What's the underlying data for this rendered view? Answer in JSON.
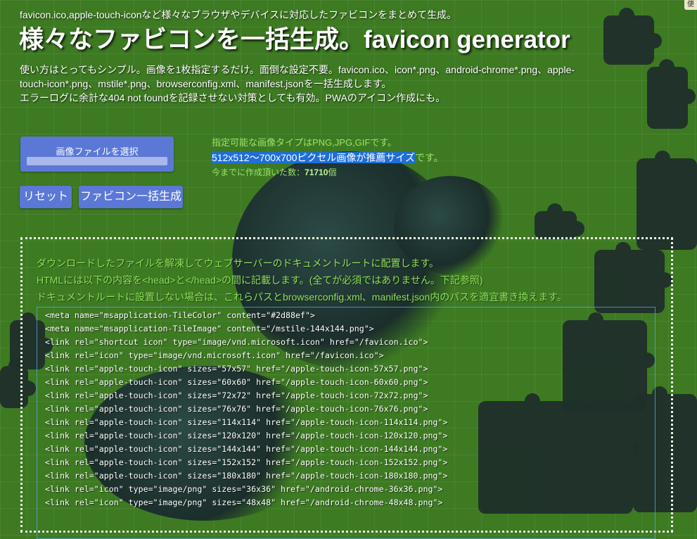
{
  "header": {
    "tagline": "favicon.ico,apple-touch-iconなど様々なブラウザやデバイスに対応したファビコンをまとめて生成。",
    "title": "様々なファビコンを一括生成。favicon generator"
  },
  "intro": {
    "lines": [
      "使い方はとってもシンプル。画像を1枚指定するだけ。面倒な設定不要。favicon.ico、icon*.png、android-chrome*.png、apple-",
      "touch-icon*.png、mstile*.png、browserconfig.xml、manifest.jsonを一括生成します。",
      "エラーログに余計な404 not foundを記録させない対策としても有効。PWAのアイコン作成にも。"
    ]
  },
  "upload": {
    "file_button_label": "画像ファイルを選択"
  },
  "info": {
    "types": "指定可能な画像タイプはPNG,JPG,GIFです。",
    "size_selected": "512x512～700x700ピクセル画像が推薦サイズ",
    "size_suffix": "です。",
    "count_label": "今までに作成頂いた数：",
    "count_value": "71710",
    "count_unit": "個"
  },
  "actions": {
    "reset_label": "リセット",
    "generate_label": "ファビコン一括生成"
  },
  "panel": {
    "lines": [
      "ダウンロードしたファイルを解凍してウェブサーバーのドキュメントルートに配置します。",
      "HTMLには以下の内容を<head>と</head>の間に記載します。(全てが必須ではありません。下記参照)",
      "ドキュメントルートに設置しない場合は、これらパスとbrowserconfig.xml、manifest.json内のパスを適宜書き換えます。"
    ],
    "code": [
      "<meta name=\"msapplication-TileColor\" content=\"#2d88ef\">",
      "<meta name=\"msapplication-TileImage\" content=\"/mstile-144x144.png\">",
      "<link rel=\"shortcut icon\" type=\"image/vnd.microsoft.icon\" href=\"/favicon.ico\">",
      "<link rel=\"icon\" type=\"image/vnd.microsoft.icon\" href=\"/favicon.ico\">",
      "<link rel=\"apple-touch-icon\" sizes=\"57x57\" href=\"/apple-touch-icon-57x57.png\">",
      "<link rel=\"apple-touch-icon\" sizes=\"60x60\" href=\"/apple-touch-icon-60x60.png\">",
      "<link rel=\"apple-touch-icon\" sizes=\"72x72\" href=\"/apple-touch-icon-72x72.png\">",
      "<link rel=\"apple-touch-icon\" sizes=\"76x76\" href=\"/apple-touch-icon-76x76.png\">",
      "<link rel=\"apple-touch-icon\" sizes=\"114x114\" href=\"/apple-touch-icon-114x114.png\">",
      "<link rel=\"apple-touch-icon\" sizes=\"120x120\" href=\"/apple-touch-icon-120x120.png\">",
      "<link rel=\"apple-touch-icon\" sizes=\"144x144\" href=\"/apple-touch-icon-144x144.png\">",
      "<link rel=\"apple-touch-icon\" sizes=\"152x152\" href=\"/apple-touch-icon-152x152.png\">",
      "<link rel=\"apple-touch-icon\" sizes=\"180x180\" href=\"/apple-touch-icon-180x180.png\">",
      "<link rel=\"icon\" type=\"image/png\" sizes=\"36x36\" href=\"/android-chrome-36x36.png\">",
      "<link rel=\"icon\" type=\"image/png\" sizes=\"48x48\" href=\"/android-chrome-48x48.png\">"
    ]
  },
  "corner_label": "便",
  "colors": {
    "background": "#3d7a22",
    "button": "#5b78d6",
    "info_text": "#9de36c",
    "selection": "#1e6fd9",
    "code_border": "#5aaae6"
  }
}
